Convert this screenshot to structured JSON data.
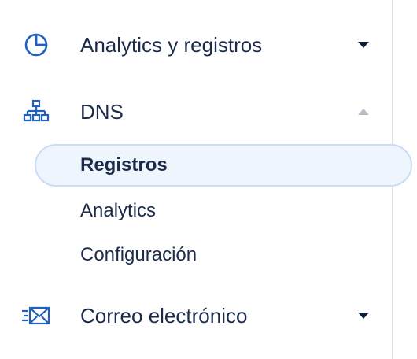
{
  "nav": {
    "analytics": {
      "label": "Analytics y registros",
      "icon": "pie-chart-icon",
      "state": "collapsed"
    },
    "dns": {
      "label": "DNS",
      "icon": "sitemap-icon",
      "state": "expanded",
      "subitems": [
        {
          "label": "Registros",
          "active": true
        },
        {
          "label": "Analytics",
          "active": false
        },
        {
          "label": "Configuración",
          "active": false
        }
      ]
    },
    "email": {
      "label": "Correo electrónico",
      "icon": "fast-mail-icon",
      "state": "collapsed"
    }
  },
  "colors": {
    "icon_blue": "#1e5fbf",
    "text": "#1c2b4a",
    "active_bg": "#eef5fd",
    "active_border": "#c9ddf5",
    "caret_collapsed": "#0d1e3a",
    "caret_expanded": "#b5bcc6",
    "divider": "#dfe2e6"
  }
}
